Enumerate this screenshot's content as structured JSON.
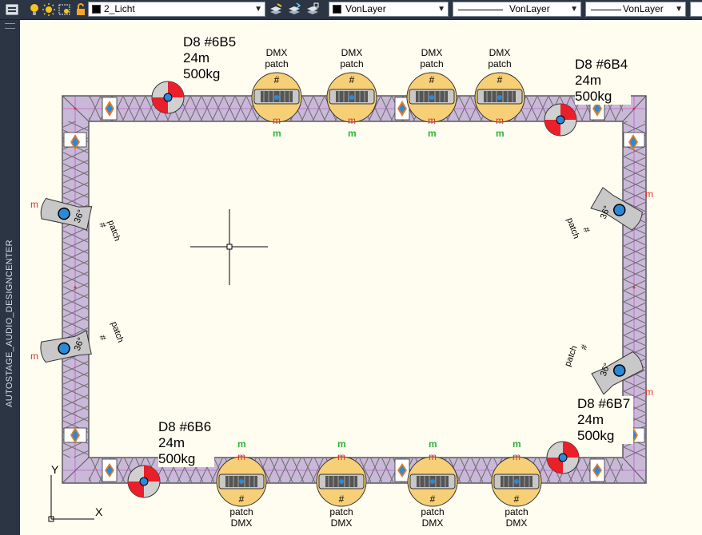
{
  "toolbar": {
    "layer_name": "2_Licht",
    "color_value": "VonLayer",
    "linetype_value": "VonLayer",
    "lineweight_value": "VonLayer",
    "layer_swatch_color": "#000000",
    "icons": [
      "layer-properties-icon",
      "lightbulb-icon",
      "sun-icon",
      "freeze-viewport-icon",
      "lock-icon",
      "layer-match-icon",
      "layer-walk-icon",
      "layer-iso-icon"
    ]
  },
  "sidebar": {
    "title": "AUTOSTAGE_AUDIO_DESIGNCENTER"
  },
  "motors": [
    {
      "name": "D8  #6B5",
      "length": "24m",
      "load": "500kg"
    },
    {
      "name": "D8  #6B4",
      "length": "24m",
      "load": "500kg"
    },
    {
      "name": "D8  #6B6",
      "length": "24m",
      "load": "500kg"
    },
    {
      "name": "D8  #6B7",
      "length": "24m",
      "load": "500kg"
    }
  ],
  "fixtures": {
    "dmx_label": "DMX",
    "patch_label": "patch",
    "hash_label": "#",
    "m_label": "m",
    "angle_label": "36°"
  },
  "colors": {
    "truss": "#c9b8d8",
    "motor_red": "#e8202a",
    "fixture_fill": "#f7cf77",
    "crosshair": "#000000"
  },
  "ucs": {
    "x_label": "X",
    "y_label": "Y"
  }
}
